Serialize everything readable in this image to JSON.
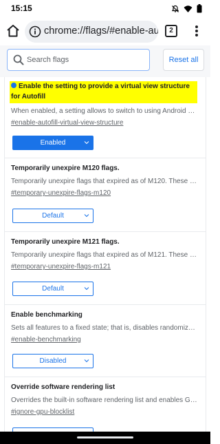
{
  "status_bar": {
    "time": "15:15"
  },
  "toolbar": {
    "url": "chrome://flags/#enable-autof",
    "tab_count": "2"
  },
  "search": {
    "placeholder": "Search flags",
    "value": "",
    "reset_label": "Reset all"
  },
  "flags": [
    {
      "title": "Enable the setting to provide a virtual view structure for Autofill",
      "description": "When enabled, a setting allows to switch to using Android …",
      "link": "#enable-autofill-virtual-view-structure",
      "value": "Enabled",
      "highlighted": true
    },
    {
      "title": "Temporarily unexpire M120 flags.",
      "description": "Temporarily unexpire flags that expired as of M120. These …",
      "link": "#temporary-unexpire-flags-m120",
      "value": "Default"
    },
    {
      "title": "Temporarily unexpire M121 flags.",
      "description": "Temporarily unexpire flags that expired as of M121. These …",
      "link": "#temporary-unexpire-flags-m121",
      "value": "Default"
    },
    {
      "title": "Enable benchmarking",
      "description": "Sets all features to a fixed state; that is, disables randomiz…",
      "link": "#enable-benchmarking",
      "value": "Disabled"
    },
    {
      "title": "Override software rendering list",
      "description": "Overrides the built-in software rendering list and enables G…",
      "link": "#ignore-gpu-blocklist",
      "value": ""
    }
  ],
  "colors": {
    "accent": "#1a73e8",
    "highlight": "#ffff00"
  },
  "icons": [
    "home-icon",
    "info-icon",
    "tabs-icon",
    "more-vert-icon",
    "search-icon",
    "chevron-down-icon",
    "mute-icon",
    "wifi-icon",
    "battery-icon"
  ]
}
